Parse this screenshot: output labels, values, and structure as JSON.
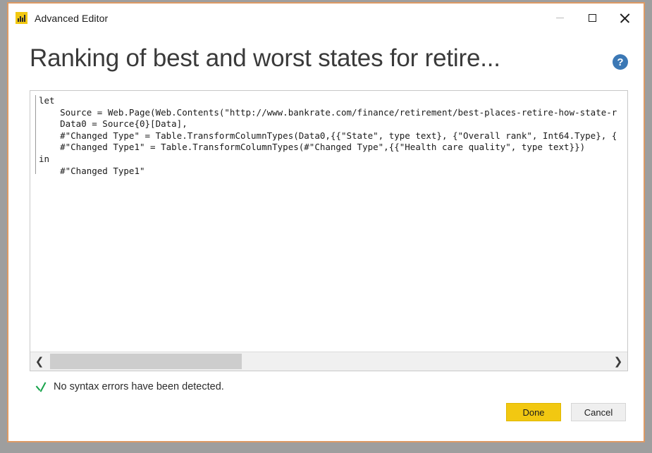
{
  "window": {
    "app_icon": "power-bi-icon",
    "title": "Advanced Editor",
    "controls": {
      "minimize": "minimize-icon",
      "maximize": "maximize-icon",
      "close": "close-icon"
    },
    "border_color": "#dd9a64"
  },
  "heading": {
    "title": "Ranking of best and worst states for retire...",
    "help_icon": "help-circle-icon",
    "help_label": "?",
    "help_color": "#3b78b5"
  },
  "editor": {
    "code": "let\n    Source = Web.Page(Web.Contents(\"http://www.bankrate.com/finance/retirement/best-places-retire-how-state-r\n    Data0 = Source{0}[Data],\n    #\"Changed Type\" = Table.TransformColumnTypes(Data0,{{\"State\", type text}, {\"Overall rank\", Int64.Type}, {\n    #\"Changed Type1\" = Table.TransformColumnTypes(#\"Changed Type\",{{\"Health care quality\", type text}})\nin\n    #\"Changed Type1\"",
    "scrollbar": {
      "left_arrow": "❮",
      "right_arrow": "❯",
      "thumb_name": "horizontal-scroll-thumb"
    }
  },
  "status": {
    "icon": "check-mark-icon",
    "icon_color": "#16a34a",
    "message": "No syntax errors have been detected."
  },
  "footer": {
    "done_label": "Done",
    "cancel_label": "Cancel",
    "done_color": "#f2c811",
    "cancel_color": "#efefef"
  }
}
